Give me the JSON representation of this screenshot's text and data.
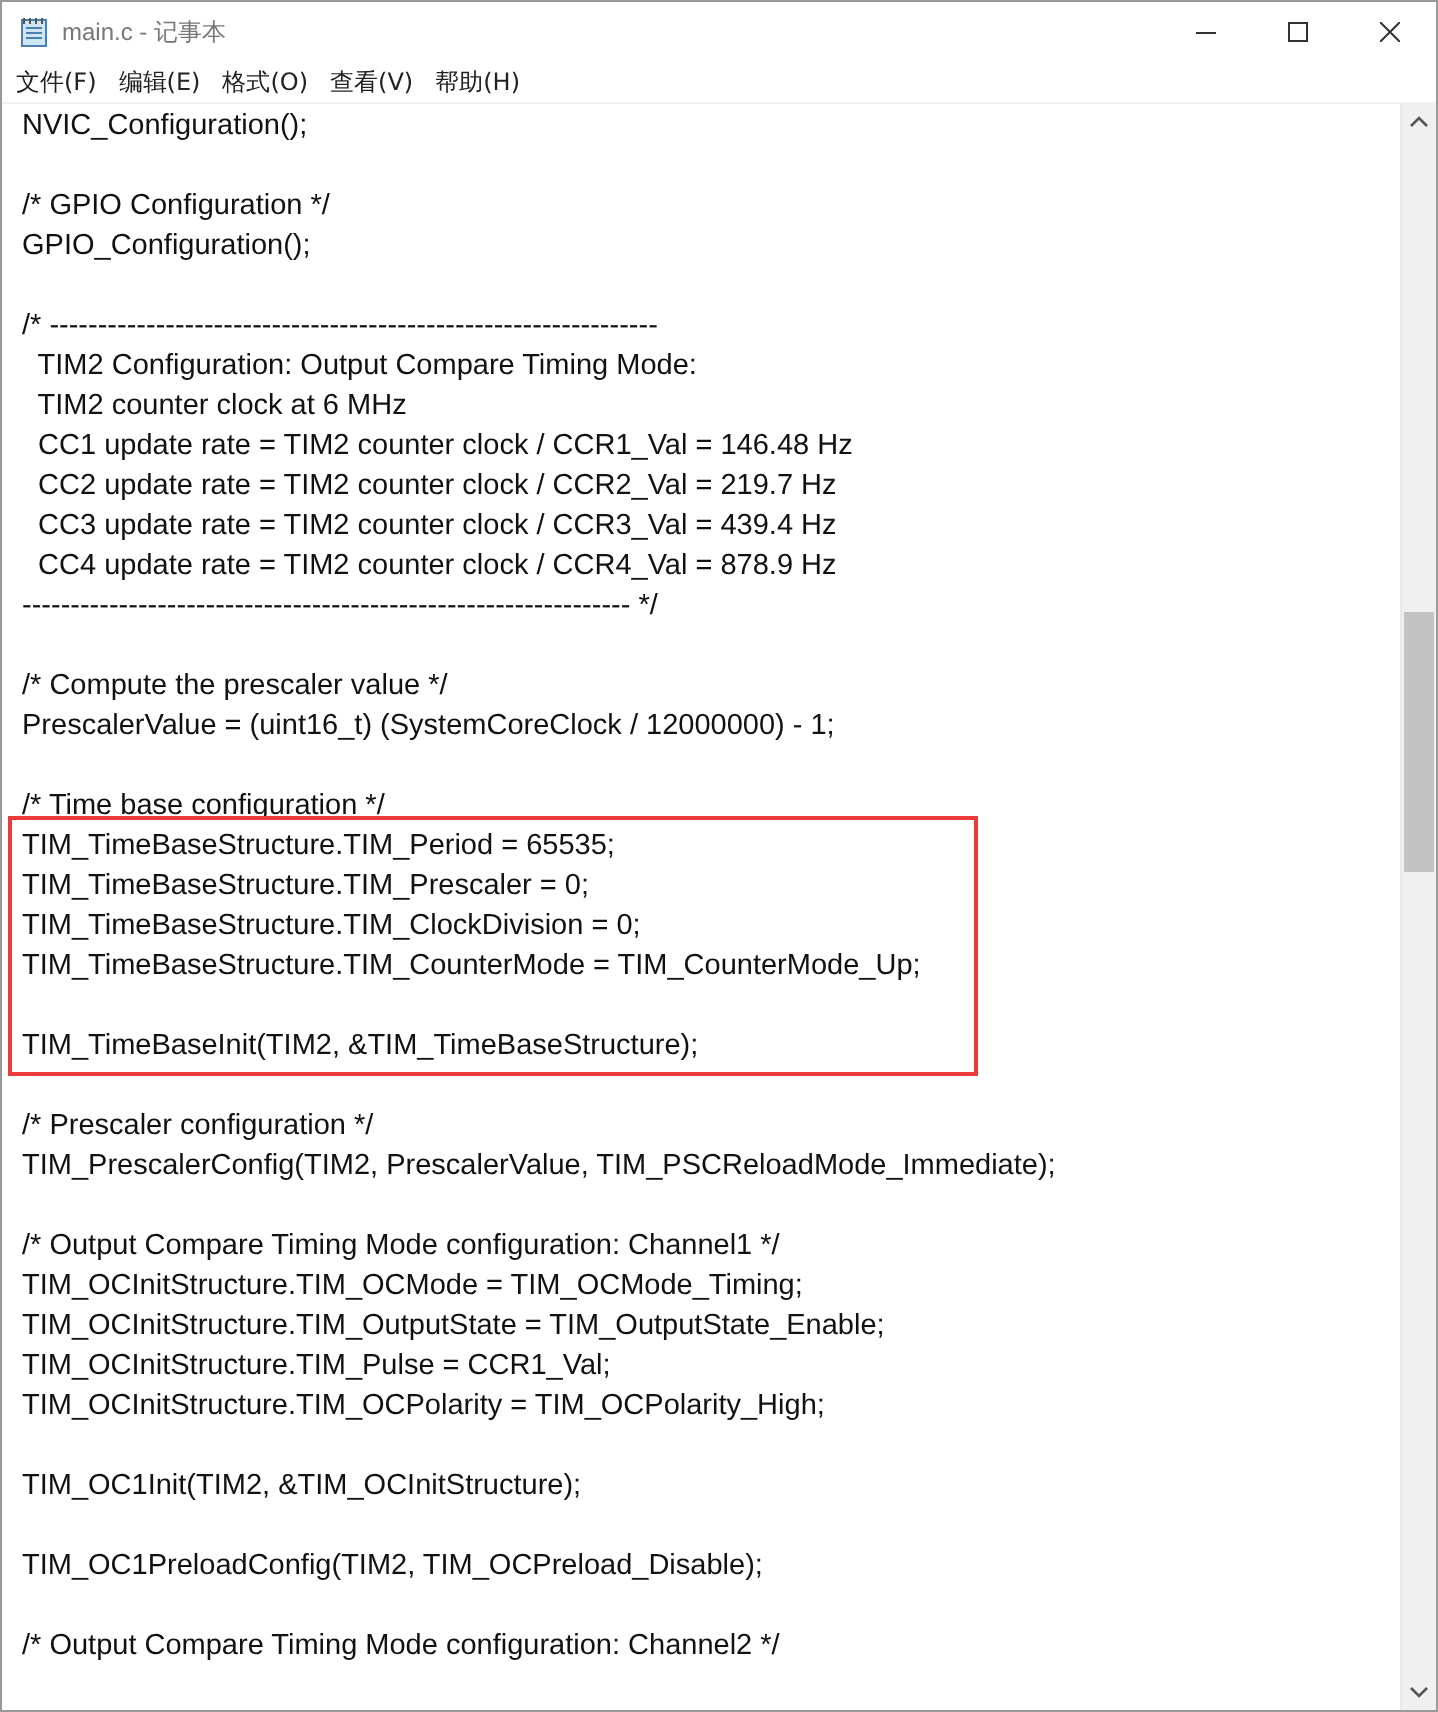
{
  "window": {
    "title": "main.c - 记事本"
  },
  "menu": [
    "文件(F)",
    "编辑(E)",
    "格式(O)",
    "查看(V)",
    "帮助(H)"
  ],
  "segments": [
    {
      "boxed": false,
      "lines": [
        {
          "kind": "code",
          "text": "NVIC_Configuration();"
        },
        {
          "kind": "blank"
        },
        {
          "kind": "code",
          "text": "/* GPIO Configuration */"
        },
        {
          "kind": "code",
          "text": "GPIO_Configuration();"
        },
        {
          "kind": "blank"
        },
        {
          "kind": "code",
          "text": "/* ---------------------------------------------------------------"
        },
        {
          "kind": "code",
          "text": "  TIM2 Configuration: Output Compare Timing Mode:"
        },
        {
          "kind": "code",
          "text": "  TIM2 counter clock at 6 MHz"
        },
        {
          "kind": "code",
          "text": "  CC1 update rate = TIM2 counter clock / CCR1_Val = 146.48 Hz"
        },
        {
          "kind": "code",
          "text": "  CC2 update rate = TIM2 counter clock / CCR2_Val = 219.7 Hz"
        },
        {
          "kind": "code",
          "text": "  CC3 update rate = TIM2 counter clock / CCR3_Val = 439.4 Hz"
        },
        {
          "kind": "code",
          "text": "  CC4 update rate = TIM2 counter clock / CCR4_Val = 878.9 Hz"
        },
        {
          "kind": "code",
          "text": "--------------------------------------------------------------- */"
        },
        {
          "kind": "blank"
        },
        {
          "kind": "code",
          "text": "/* Compute the prescaler value */"
        },
        {
          "kind": "code",
          "text": "PrescalerValue = (uint16_t) (SystemCoreClock / 12000000) - 1;"
        },
        {
          "kind": "blank"
        },
        {
          "kind": "code",
          "text": "/* Time base configuration */"
        }
      ]
    },
    {
      "boxed": true,
      "lines": [
        {
          "kind": "code",
          "text": "TIM_TimeBaseStructure.TIM_Period = 65535;"
        },
        {
          "kind": "code",
          "text": "TIM_TimeBaseStructure.TIM_Prescaler = 0;"
        },
        {
          "kind": "code",
          "text": "TIM_TimeBaseStructure.TIM_ClockDivision = 0;"
        },
        {
          "kind": "code",
          "text": "TIM_TimeBaseStructure.TIM_CounterMode = TIM_CounterMode_Up;"
        },
        {
          "kind": "blank"
        },
        {
          "kind": "code",
          "text": "TIM_TimeBaseInit(TIM2, &TIM_TimeBaseStructure);"
        }
      ]
    },
    {
      "boxed": false,
      "lines": [
        {
          "kind": "blank"
        },
        {
          "kind": "code",
          "text": "/* Prescaler configuration */"
        },
        {
          "kind": "code",
          "text": "TIM_PrescalerConfig(TIM2, PrescalerValue, TIM_PSCReloadMode_Immediate);"
        },
        {
          "kind": "blank"
        },
        {
          "kind": "code",
          "text": "/* Output Compare Timing Mode configuration: Channel1 */"
        },
        {
          "kind": "code",
          "text": "TIM_OCInitStructure.TIM_OCMode = TIM_OCMode_Timing;"
        },
        {
          "kind": "code",
          "text": "TIM_OCInitStructure.TIM_OutputState = TIM_OutputState_Enable;"
        },
        {
          "kind": "code",
          "text": "TIM_OCInitStructure.TIM_Pulse = CCR1_Val;"
        },
        {
          "kind": "code",
          "text": "TIM_OCInitStructure.TIM_OCPolarity = TIM_OCPolarity_High;"
        },
        {
          "kind": "blank"
        },
        {
          "kind": "code",
          "text": "TIM_OC1Init(TIM2, &TIM_OCInitStructure);"
        },
        {
          "kind": "blank"
        },
        {
          "kind": "code",
          "text": "TIM_OC1PreloadConfig(TIM2, TIM_OCPreload_Disable);"
        },
        {
          "kind": "blank"
        },
        {
          "kind": "code",
          "text": "/* Output Compare Timing Mode configuration: Channel2 */"
        }
      ]
    }
  ]
}
